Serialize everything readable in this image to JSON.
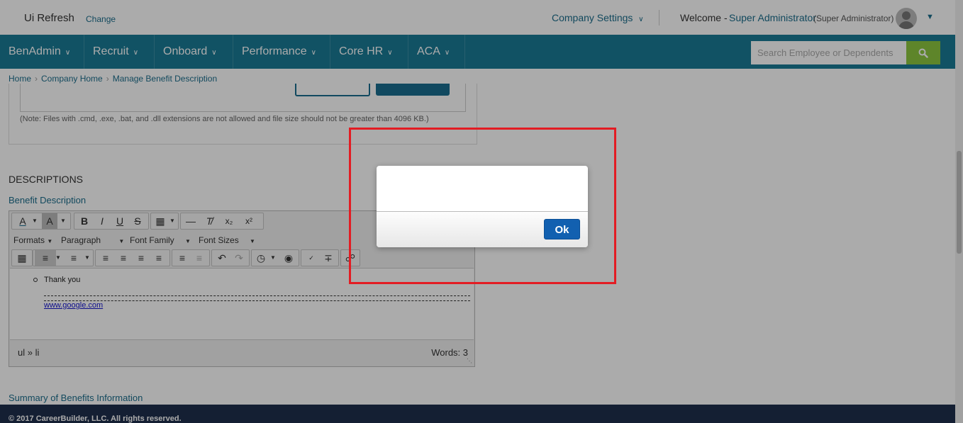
{
  "header": {
    "app_title": "Ui Refresh",
    "change_link": "Change",
    "company_settings": "Company Settings",
    "welcome": "Welcome -",
    "user_name": "Super Administrator",
    "user_role": "(Super Administrator)"
  },
  "nav": {
    "items": [
      {
        "label": "BenAdmin"
      },
      {
        "label": "Recruit"
      },
      {
        "label": "Onboard"
      },
      {
        "label": "Performance"
      },
      {
        "label": "Core HR"
      },
      {
        "label": "ACA"
      }
    ],
    "search_placeholder": "Search Employee or Dependents"
  },
  "breadcrumb": [
    "Home",
    "Company Home",
    "Manage Benefit Description"
  ],
  "content": {
    "file_note": "(Note: Files with .cmd, .exe, .bat, and .dll extensions are not allowed and file size should not be greater than 4096 KB.)",
    "descriptions_heading": "DESCRIPTIONS",
    "benefit_description_label": "Benefit Description",
    "summary_label": "Summary of Benefits Information"
  },
  "editor": {
    "dropdowns": [
      "Formats",
      "Paragraph",
      "Font Family",
      "Font Sizes"
    ],
    "list_item": "Thank you",
    "link": "www.google.com",
    "path": "ul » li",
    "word_count": "Words: 3"
  },
  "dialog": {
    "message": "",
    "ok_label": "Ok"
  },
  "footer": {
    "copyright": "© 2017 CareerBuilder, LLC. All rights reserved."
  },
  "colors": {
    "nav_bg": "#1a7b96",
    "link": "#1c6e8c",
    "search_button": "#8cc63f",
    "footer_bg": "#1e2f4d",
    "ok_button": "#1260b0",
    "highlight": "#e31c23"
  }
}
